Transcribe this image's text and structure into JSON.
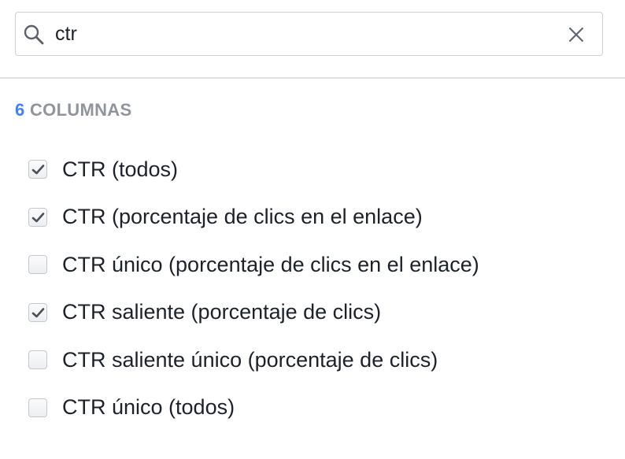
{
  "search": {
    "value": "ctr",
    "placeholder": ""
  },
  "section": {
    "count": "6",
    "title": "COLUMNAS"
  },
  "options": [
    {
      "label": "CTR (todos)",
      "checked": true
    },
    {
      "label": "CTR (porcentaje de clics en el enlace)",
      "checked": true
    },
    {
      "label": "CTR único (porcentaje de clics en el enlace)",
      "checked": false
    },
    {
      "label": "CTR saliente (porcentaje de clics)",
      "checked": true
    },
    {
      "label": "CTR saliente único (porcentaje de clics)",
      "checked": false
    },
    {
      "label": "CTR único (todos)",
      "checked": false
    }
  ],
  "colors": {
    "accent": "#4080ff",
    "section_title": "#90949c",
    "checkmark": "#4b4f56"
  },
  "icons": {
    "search": "search-icon",
    "clear": "close-icon",
    "check": "check-icon"
  }
}
